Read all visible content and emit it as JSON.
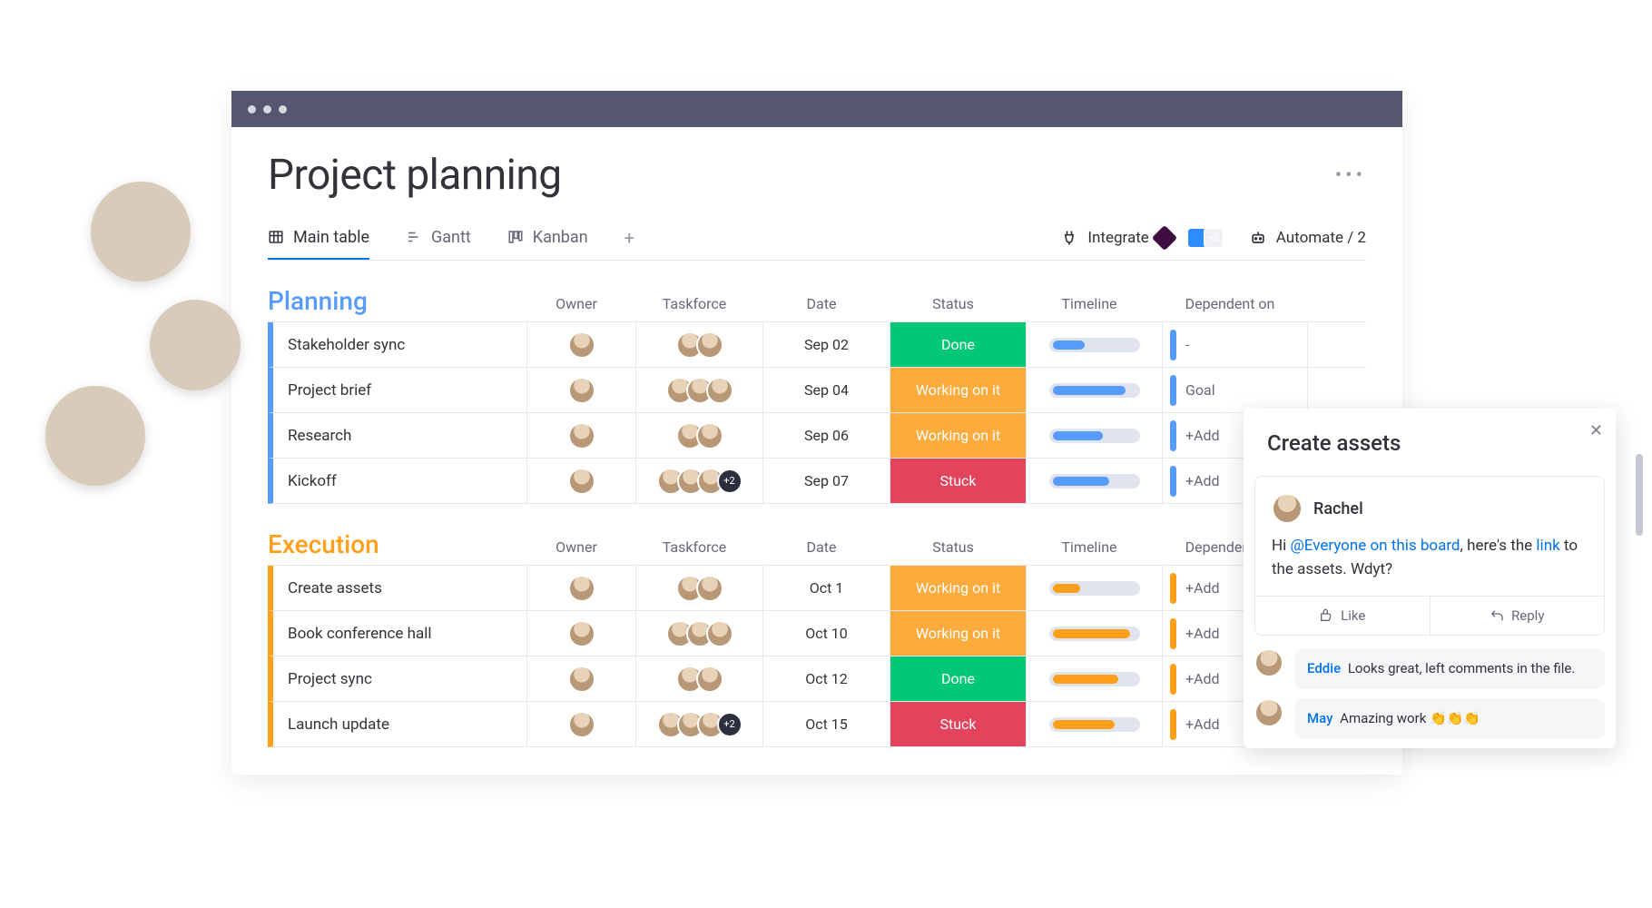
{
  "page_title": "Project planning",
  "views": {
    "main_table": "Main table",
    "gantt": "Gantt",
    "kanban": "Kanban"
  },
  "tools": {
    "integrate": "Integrate",
    "automate": "Automate / 2",
    "integ_count": "+2"
  },
  "columns": {
    "owner": "Owner",
    "taskforce": "Taskforce",
    "date": "Date",
    "status": "Status",
    "timeline": "Timeline",
    "dependent": "Dependent on"
  },
  "status_labels": {
    "done": "Done",
    "working": "Working on it",
    "stuck": "Stuck"
  },
  "groups": {
    "planning": {
      "title": "Planning",
      "rows": [
        {
          "name": "Stakeholder sync",
          "date": "Sep 02",
          "status": "done",
          "taskforce": 2,
          "timeline": 35,
          "dep": "-"
        },
        {
          "name": "Project brief",
          "date": "Sep 04",
          "status": "working",
          "taskforce": 3,
          "timeline": 80,
          "dep": "Goal"
        },
        {
          "name": "Research",
          "date": "Sep 06",
          "status": "working",
          "taskforce": 2,
          "timeline": 55,
          "dep": "+Add"
        },
        {
          "name": "Kickoff",
          "date": "Sep 07",
          "status": "stuck",
          "taskforce": 3,
          "extra": "+2",
          "timeline": 62,
          "dep": "+Add"
        }
      ]
    },
    "execution": {
      "title": "Execution",
      "rows": [
        {
          "name": "Create assets",
          "date": "Oct 1",
          "status": "working",
          "taskforce": 2,
          "timeline": 30,
          "dep": "+Add"
        },
        {
          "name": "Book conference hall",
          "date": "Oct 10",
          "status": "working",
          "taskforce": 3,
          "timeline": 85,
          "dep": "+Add"
        },
        {
          "name": "Project sync",
          "date": "Oct 12",
          "status": "done",
          "taskforce": 2,
          "timeline": 72,
          "dep": "+Add"
        },
        {
          "name": "Launch update",
          "date": "Oct 15",
          "status": "stuck",
          "taskforce": 3,
          "extra": "+2",
          "timeline": 68,
          "dep": "+Add"
        }
      ]
    }
  },
  "panel": {
    "title": "Create assets",
    "author": "Rachel",
    "body_pre": "Hi ",
    "mention": "@Everyone on this board",
    "body_mid": ", here's the ",
    "link": "link",
    "body_post": " to the assets. Wdyt?",
    "like": "Like",
    "reply": "Reply",
    "replies": [
      {
        "name": "Eddie",
        "text": "Looks great, left comments in the file."
      },
      {
        "name": "May",
        "text": "Amazing work 👏👏👏"
      }
    ]
  }
}
